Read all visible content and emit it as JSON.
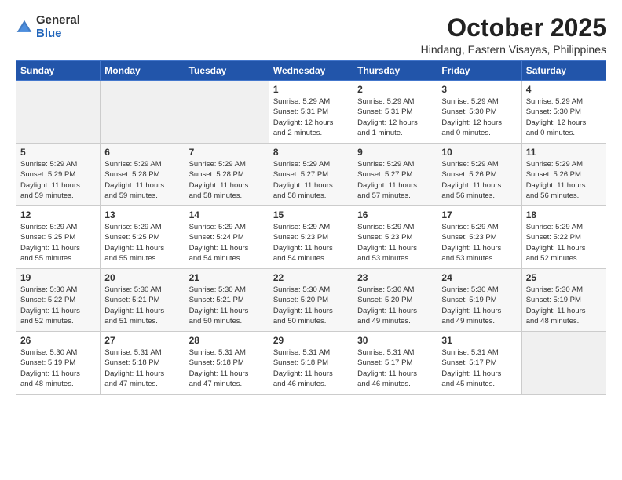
{
  "logo": {
    "general": "General",
    "blue": "Blue"
  },
  "header": {
    "month": "October 2025",
    "location": "Hindang, Eastern Visayas, Philippines"
  },
  "weekdays": [
    "Sunday",
    "Monday",
    "Tuesday",
    "Wednesday",
    "Thursday",
    "Friday",
    "Saturday"
  ],
  "weeks": [
    [
      {
        "day": "",
        "info": ""
      },
      {
        "day": "",
        "info": ""
      },
      {
        "day": "",
        "info": ""
      },
      {
        "day": "1",
        "info": "Sunrise: 5:29 AM\nSunset: 5:31 PM\nDaylight: 12 hours\nand 2 minutes."
      },
      {
        "day": "2",
        "info": "Sunrise: 5:29 AM\nSunset: 5:31 PM\nDaylight: 12 hours\nand 1 minute."
      },
      {
        "day": "3",
        "info": "Sunrise: 5:29 AM\nSunset: 5:30 PM\nDaylight: 12 hours\nand 0 minutes."
      },
      {
        "day": "4",
        "info": "Sunrise: 5:29 AM\nSunset: 5:30 PM\nDaylight: 12 hours\nand 0 minutes."
      }
    ],
    [
      {
        "day": "5",
        "info": "Sunrise: 5:29 AM\nSunset: 5:29 PM\nDaylight: 11 hours\nand 59 minutes."
      },
      {
        "day": "6",
        "info": "Sunrise: 5:29 AM\nSunset: 5:28 PM\nDaylight: 11 hours\nand 59 minutes."
      },
      {
        "day": "7",
        "info": "Sunrise: 5:29 AM\nSunset: 5:28 PM\nDaylight: 11 hours\nand 58 minutes."
      },
      {
        "day": "8",
        "info": "Sunrise: 5:29 AM\nSunset: 5:27 PM\nDaylight: 11 hours\nand 58 minutes."
      },
      {
        "day": "9",
        "info": "Sunrise: 5:29 AM\nSunset: 5:27 PM\nDaylight: 11 hours\nand 57 minutes."
      },
      {
        "day": "10",
        "info": "Sunrise: 5:29 AM\nSunset: 5:26 PM\nDaylight: 11 hours\nand 56 minutes."
      },
      {
        "day": "11",
        "info": "Sunrise: 5:29 AM\nSunset: 5:26 PM\nDaylight: 11 hours\nand 56 minutes."
      }
    ],
    [
      {
        "day": "12",
        "info": "Sunrise: 5:29 AM\nSunset: 5:25 PM\nDaylight: 11 hours\nand 55 minutes."
      },
      {
        "day": "13",
        "info": "Sunrise: 5:29 AM\nSunset: 5:25 PM\nDaylight: 11 hours\nand 55 minutes."
      },
      {
        "day": "14",
        "info": "Sunrise: 5:29 AM\nSunset: 5:24 PM\nDaylight: 11 hours\nand 54 minutes."
      },
      {
        "day": "15",
        "info": "Sunrise: 5:29 AM\nSunset: 5:23 PM\nDaylight: 11 hours\nand 54 minutes."
      },
      {
        "day": "16",
        "info": "Sunrise: 5:29 AM\nSunset: 5:23 PM\nDaylight: 11 hours\nand 53 minutes."
      },
      {
        "day": "17",
        "info": "Sunrise: 5:29 AM\nSunset: 5:23 PM\nDaylight: 11 hours\nand 53 minutes."
      },
      {
        "day": "18",
        "info": "Sunrise: 5:29 AM\nSunset: 5:22 PM\nDaylight: 11 hours\nand 52 minutes."
      }
    ],
    [
      {
        "day": "19",
        "info": "Sunrise: 5:30 AM\nSunset: 5:22 PM\nDaylight: 11 hours\nand 52 minutes."
      },
      {
        "day": "20",
        "info": "Sunrise: 5:30 AM\nSunset: 5:21 PM\nDaylight: 11 hours\nand 51 minutes."
      },
      {
        "day": "21",
        "info": "Sunrise: 5:30 AM\nSunset: 5:21 PM\nDaylight: 11 hours\nand 50 minutes."
      },
      {
        "day": "22",
        "info": "Sunrise: 5:30 AM\nSunset: 5:20 PM\nDaylight: 11 hours\nand 50 minutes."
      },
      {
        "day": "23",
        "info": "Sunrise: 5:30 AM\nSunset: 5:20 PM\nDaylight: 11 hours\nand 49 minutes."
      },
      {
        "day": "24",
        "info": "Sunrise: 5:30 AM\nSunset: 5:19 PM\nDaylight: 11 hours\nand 49 minutes."
      },
      {
        "day": "25",
        "info": "Sunrise: 5:30 AM\nSunset: 5:19 PM\nDaylight: 11 hours\nand 48 minutes."
      }
    ],
    [
      {
        "day": "26",
        "info": "Sunrise: 5:30 AM\nSunset: 5:19 PM\nDaylight: 11 hours\nand 48 minutes."
      },
      {
        "day": "27",
        "info": "Sunrise: 5:31 AM\nSunset: 5:18 PM\nDaylight: 11 hours\nand 47 minutes."
      },
      {
        "day": "28",
        "info": "Sunrise: 5:31 AM\nSunset: 5:18 PM\nDaylight: 11 hours\nand 47 minutes."
      },
      {
        "day": "29",
        "info": "Sunrise: 5:31 AM\nSunset: 5:18 PM\nDaylight: 11 hours\nand 46 minutes."
      },
      {
        "day": "30",
        "info": "Sunrise: 5:31 AM\nSunset: 5:17 PM\nDaylight: 11 hours\nand 46 minutes."
      },
      {
        "day": "31",
        "info": "Sunrise: 5:31 AM\nSunset: 5:17 PM\nDaylight: 11 hours\nand 45 minutes."
      },
      {
        "day": "",
        "info": ""
      }
    ]
  ]
}
